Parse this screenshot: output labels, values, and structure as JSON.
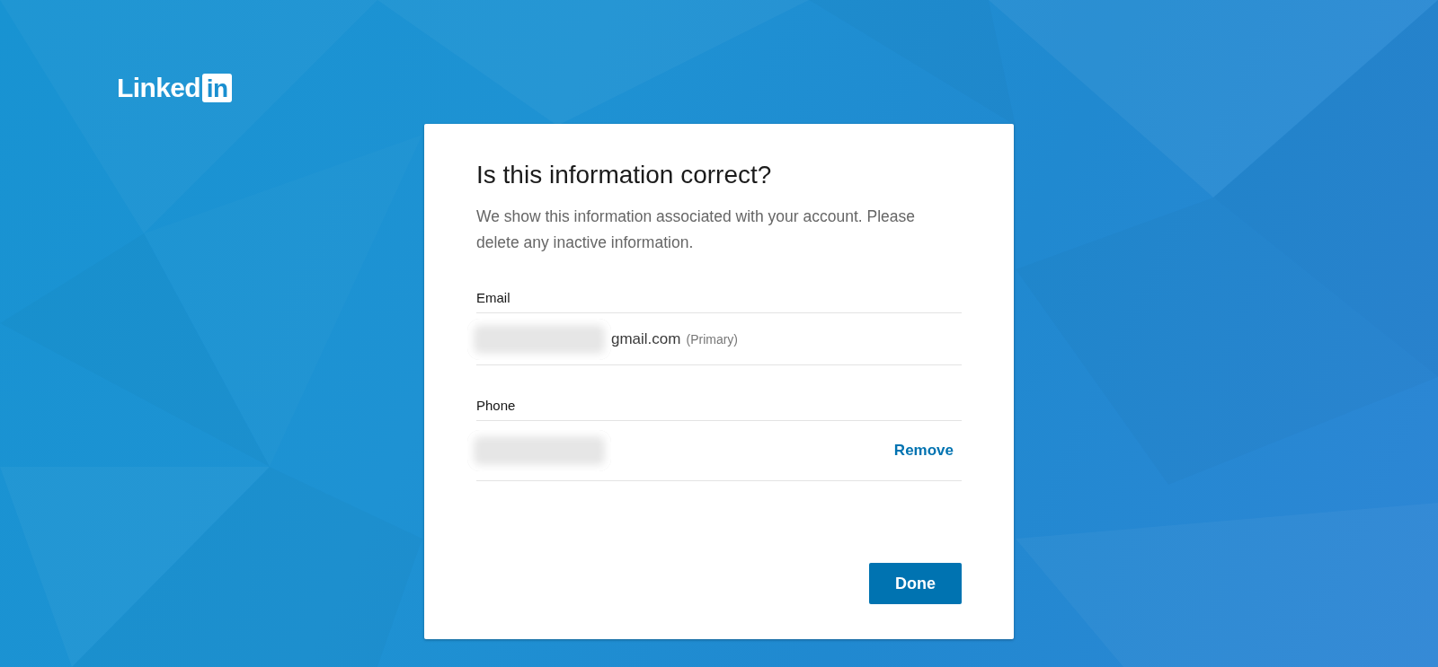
{
  "logo": {
    "wordmark": "Linked",
    "badge": "in"
  },
  "dialog": {
    "title": "Is this information correct?",
    "description": "We show this information associated with your account. Please delete any inactive information.",
    "sections": [
      {
        "label": "Email",
        "entries": [
          {
            "redacted": true,
            "value": "gmail.com",
            "note": "(Primary)"
          }
        ]
      },
      {
        "label": "Phone",
        "entries": [
          {
            "redacted": true,
            "action": "Remove"
          }
        ]
      }
    ],
    "button": "Done"
  }
}
